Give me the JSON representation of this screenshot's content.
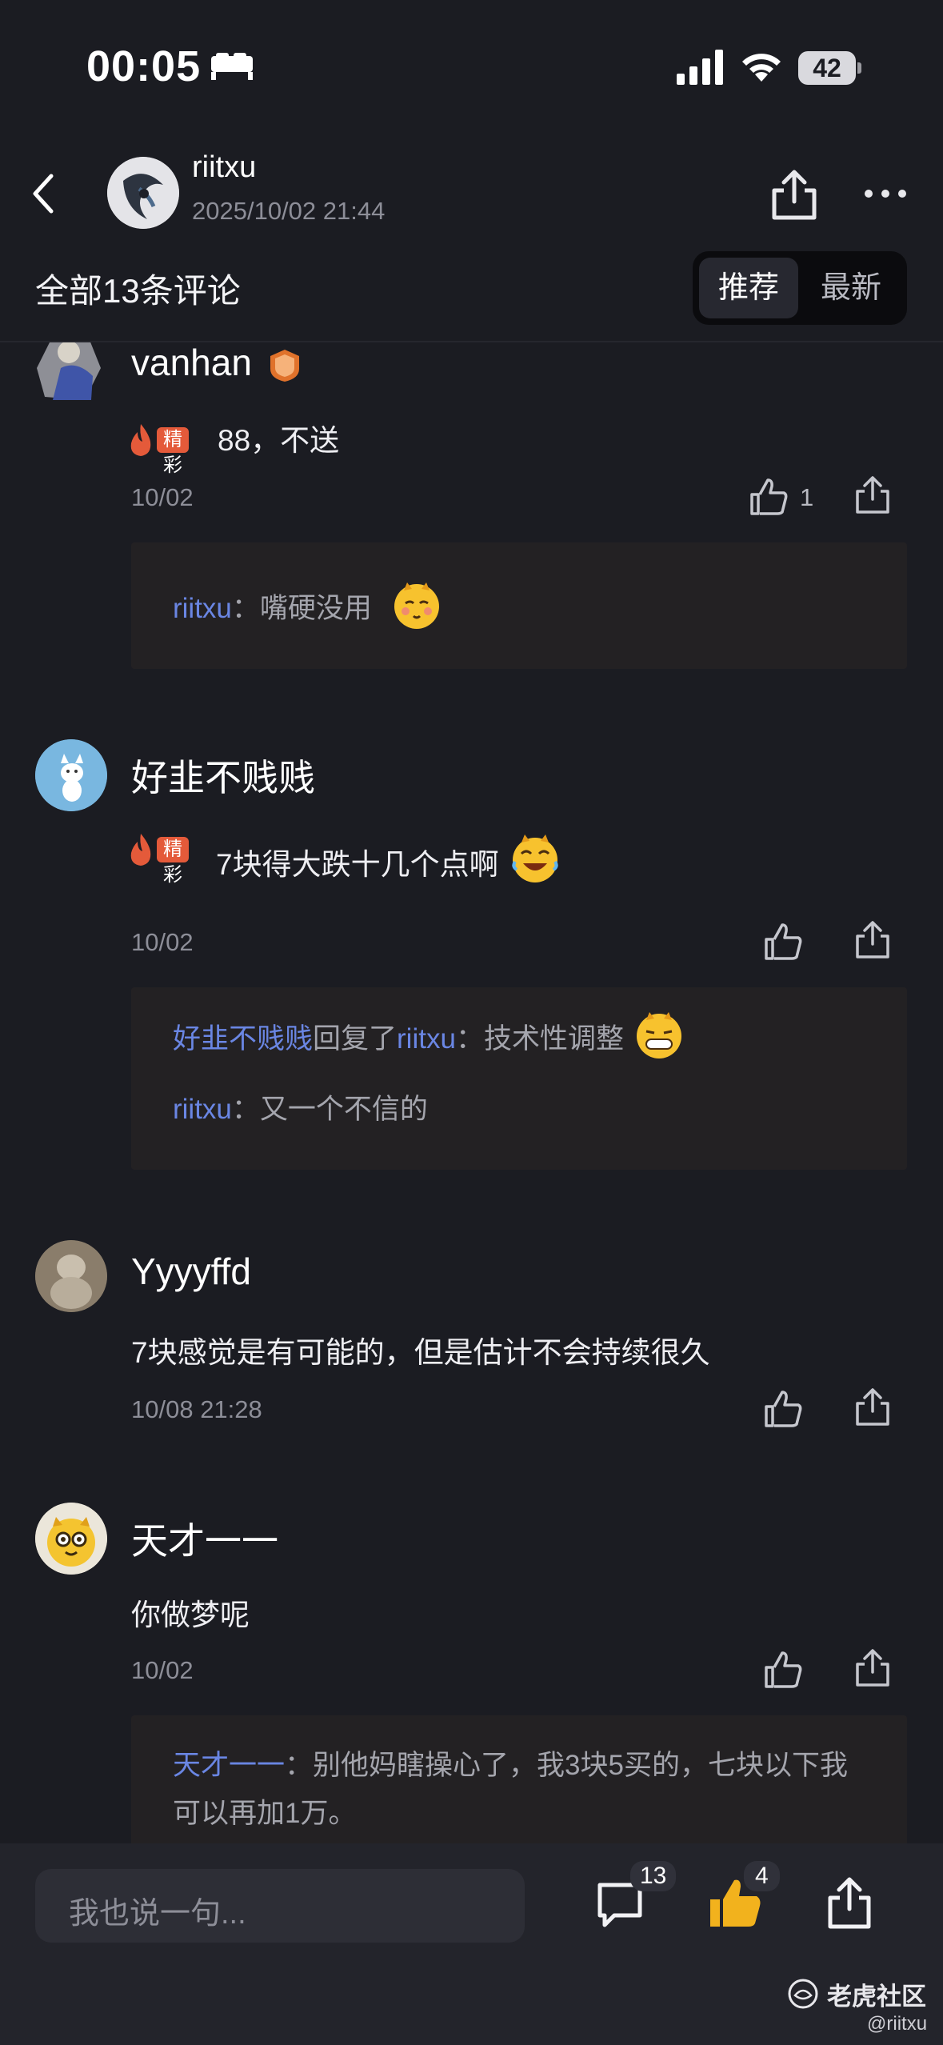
{
  "status_bar": {
    "time": "00:05",
    "battery": "42"
  },
  "header": {
    "author": "riitxu",
    "post_time": "2025/10/02 21:44"
  },
  "comments_header": {
    "count_label": "全部13条评论",
    "sort_recommend": "推荐",
    "sort_latest": "最新"
  },
  "comments": [
    {
      "user": "vanhan",
      "badge": "精彩",
      "text": "88，不送",
      "date": "10/02",
      "likes": "1",
      "replies": [
        {
          "from": "riitxu",
          "sep": "：",
          "text": "嘴硬没用"
        }
      ]
    },
    {
      "user": "好韭不贱贱",
      "badge": "精彩",
      "text": "7块得大跌十几个点啊",
      "date": "10/02",
      "replies": [
        {
          "from": "好韭不贱贱",
          "mid": "回复了",
          "to": "riitxu",
          "sep": "：",
          "text": "技术性调整"
        },
        {
          "from": "riitxu",
          "sep": "：",
          "text": "又一个不信的"
        }
      ]
    },
    {
      "user": "Yyyyffd",
      "text": "7块感觉是有可能的，但是估计不会持续很久",
      "date": "10/08 21:28"
    },
    {
      "user": "天才一一",
      "text": "你做梦呢",
      "date": "10/02",
      "replies": [
        {
          "from": "天才一一",
          "sep": "：",
          "text_line1": "别他妈瞎操心了，我3块5买的，七块以下我",
          "text_line2": "可以再加1万。"
        }
      ]
    }
  ],
  "bottom_bar": {
    "input_placeholder": "我也说一句...",
    "comment_count": "13",
    "like_count": "4"
  },
  "watermark": {
    "brand": "老虎社区",
    "handle": "@riitxu"
  },
  "colors": {
    "background": "#1b1c22",
    "link_blue": "#6a86e3",
    "accent_gold": "#f2b21d",
    "badge_orange": "#e45a3a"
  },
  "icons": [
    "bed-icon",
    "signal-icon",
    "wifi-icon",
    "back-arrow-icon",
    "share-icon",
    "more-dots-icon",
    "thumbs-up-icon",
    "comment-bubble-icon",
    "flame-icon",
    "tiger-emoji-icon",
    "shield-badge-icon"
  ]
}
